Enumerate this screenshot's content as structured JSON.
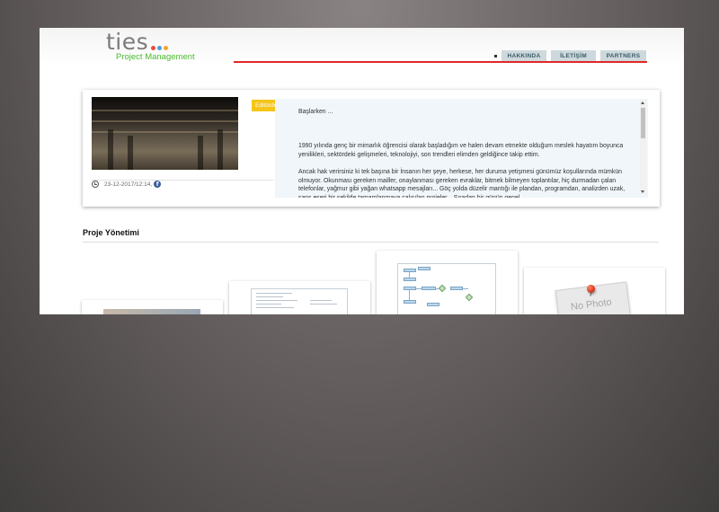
{
  "brand": {
    "wordmark": "ties",
    "tagline": "Project Management",
    "dot_colors": [
      "#e84c3d",
      "#4a9fe0",
      "#f5a623"
    ]
  },
  "nav": {
    "items": [
      {
        "label": "HAKKINDA"
      },
      {
        "label": "İLETİŞİM"
      },
      {
        "label": "PARTNERS"
      }
    ],
    "accent_color": "#e12828"
  },
  "featured": {
    "tag": "Editörden",
    "date": "23-12-2017/12:14,",
    "article": {
      "heading": "Başlarken ...",
      "paragraphs": [
        "1990 yılında genç bir mimarlık öğrencisi olarak başladığım ve halen devam etmekte olduğum meslek hayatım boyunca yenilikleri, sektördeki gelişmeleri, teknolojiyi, son trendleri elimden geldiğince takip ettim.",
        "Ancak hak verirsiniz ki tek başına bir İnsanın her şeye, herkese, her duruma yetişmesi günümüz koşullarında mümkün olmuyor. Okunması gereken mailler, onaylanması gereken evraklar, bitmek bilmeyen toplantılar, hiç durmadan çalan telefonlar, yağmur gibi yağan whatsapp mesajları... Göç yolda düzelir mantığı ile plandan, programdan, analizden uzak, şans eseri bir şekilde tamamlanmaya çalışılan projeler... Sıradan bir günün genel"
      ]
    }
  },
  "section": {
    "title": "Proje Yönetimi"
  },
  "cards": [
    {
      "thumb": "photo"
    },
    {
      "thumb": "document-icon"
    },
    {
      "thumb": "flowchart-icon"
    },
    {
      "thumb": "no-photo",
      "placeholder_text": "No Photo"
    }
  ]
}
